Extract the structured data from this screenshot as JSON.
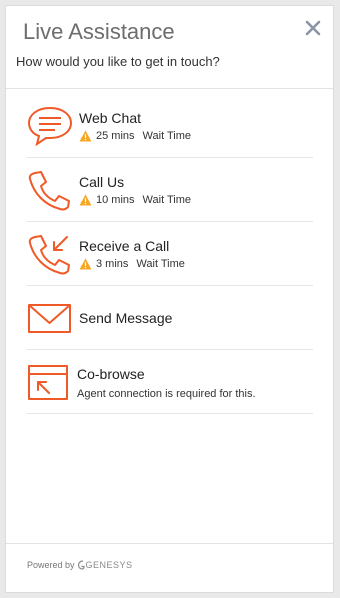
{
  "header": {
    "title": "Live Assistance",
    "subtitle": "How would you like to get in touch?",
    "close_icon": "close-icon"
  },
  "options": [
    {
      "label": "Web Chat",
      "icon": "chat-bubble-icon",
      "wait_mins": "25 mins",
      "wait_label": "Wait Time"
    },
    {
      "label": "Call Us",
      "icon": "phone-icon",
      "wait_mins": "10 mins",
      "wait_label": "Wait Time"
    },
    {
      "label": "Receive a Call",
      "icon": "phone-incoming-icon",
      "wait_mins": "3 mins",
      "wait_label": "Wait Time"
    },
    {
      "label": "Send Message",
      "icon": "envelope-icon"
    },
    {
      "label": "Co-browse",
      "icon": "cobrowse-icon",
      "note": "Agent connection is required for this."
    }
  ],
  "footer": {
    "powered_by": "Powered by",
    "brand": "GENESYS"
  },
  "colors": {
    "accent": "#f05a28",
    "warning": "#f5a623",
    "close": "#8a96a3"
  }
}
